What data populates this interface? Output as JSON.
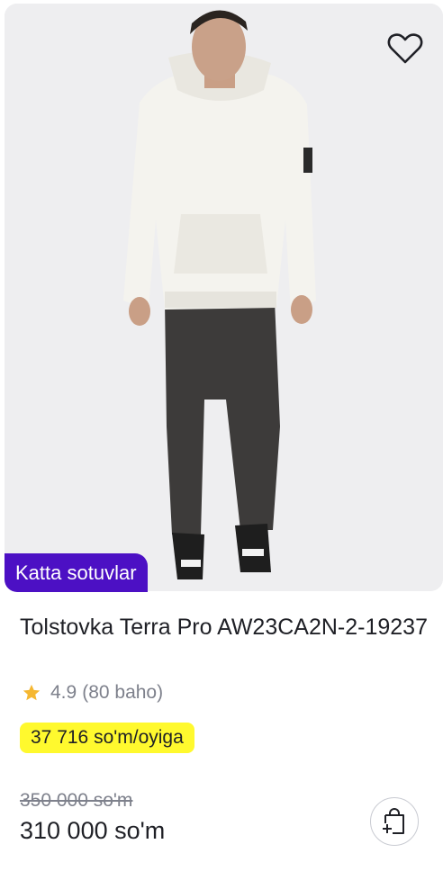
{
  "product": {
    "badge": "Katta sotuvlar",
    "title": "Tolstovka Terra Pro AW23CA2N-2-19237",
    "rating": "4.9",
    "reviews": "(80 baho)",
    "installment": "37 716 so'm/oyiga",
    "old_price": "350 000 so'm",
    "price": "310 000 so'm"
  },
  "icons": {
    "favorite": "heart-icon",
    "rating": "star-icon",
    "cart": "add-to-cart-bag-icon"
  },
  "colors": {
    "badge": "#4c10c4",
    "installment": "#fff92e",
    "star": "#f5b731"
  }
}
